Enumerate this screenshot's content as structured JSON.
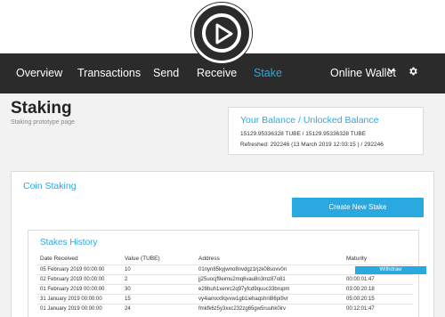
{
  "nav": {
    "items": [
      {
        "label": "Overview",
        "active": false
      },
      {
        "label": "Transactions",
        "active": false
      },
      {
        "label": "Send",
        "active": false
      },
      {
        "label": "Receive",
        "active": false
      },
      {
        "label": "Stake",
        "active": true
      }
    ],
    "wallet_label": "Online Wallet",
    "wallet_icon": "chevron-down-icon",
    "settings_icon": "gear-icon",
    "logo_icon": "play-logo-icon"
  },
  "page": {
    "title": "Staking",
    "subtitle": "Staking prototype page"
  },
  "balance": {
    "title": "Your Balance / Unlocked Balance",
    "amounts": "15129.95336328 TUBE / 15129.95336328 TUBE",
    "refreshed": "Refreshed: 292246 (13 March 2019 12:03:15 ) / 292246"
  },
  "staking": {
    "title": "Coin Staking",
    "create_button": "Create New Stake"
  },
  "history": {
    "title": "Stakes History",
    "columns": [
      "Date Received",
      "Value (TUBE)",
      "Address",
      "Maturity"
    ],
    "rows": [
      {
        "date": "05 February 2019 00:00:00",
        "value": "10",
        "address": "01nyn85kyjwno8nvdgz1rjzk08sovv0n",
        "maturity": "Withdraw",
        "maturity_is_button": true
      },
      {
        "date": "02 February 2019 00:00:00",
        "value": "2",
        "address": "jj25uocjf9eimu2mq6vau8n3mz87o81",
        "maturity": "00:00:01:47",
        "maturity_is_button": false
      },
      {
        "date": "01 February 2019 00:00:00",
        "value": "30",
        "address": "e28buh1xenrc2q97yfcd9quuc33brupm",
        "maturity": "03:00:20:18",
        "maturity_is_button": false
      },
      {
        "date": "31 January 2019 00:00:00",
        "value": "15",
        "address": "vy4iamxx9qvvw1gb1iehaqshnl86pi9vr",
        "maturity": "05:00:20:15",
        "maturity_is_button": false
      },
      {
        "date": "01 January 2019 00:00:00",
        "value": "24",
        "address": "fmkfk6z5y3xxc232zg65gw5ruuhk0irv",
        "maturity": "00:12:01:47",
        "maturity_is_button": false
      }
    ]
  },
  "colors": {
    "accent": "#29a9e0",
    "navbar": "#2b2b2b",
    "background": "#f2f2f2"
  }
}
